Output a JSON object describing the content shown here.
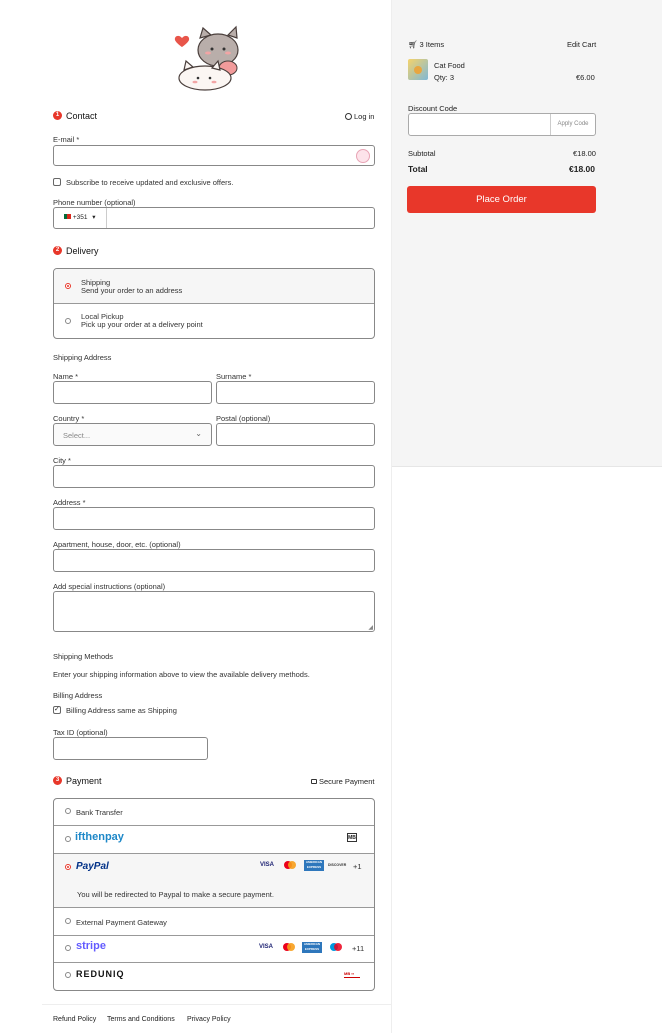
{
  "contact": {
    "step": "1",
    "title": "Contact",
    "login_label": "Log in",
    "email_label": "E-mail *",
    "email_value": "",
    "subscribe_label": "Subscribe to receive updated and exclusive offers.",
    "phone_label": "Phone number (optional)",
    "phone_code": "+351",
    "phone_value": ""
  },
  "delivery": {
    "step": "2",
    "title": "Delivery",
    "options": [
      {
        "title": "Shipping",
        "desc": "Send your order to an address",
        "selected": true
      },
      {
        "title": "Local Pickup",
        "desc": "Pick up your order at a delivery point",
        "selected": false
      }
    ]
  },
  "shipping_address": {
    "title": "Shipping Address",
    "name_label": "Name *",
    "surname_label": "Surname *",
    "country_label": "Country *",
    "country_placeholder": "Select...",
    "postal_label": "Postal (optional)",
    "city_label": "City *",
    "address_label": "Address *",
    "apartment_label": "Apartment, house, door, etc. (optional)",
    "instructions_label": "Add special instructions (optional)"
  },
  "shipping_methods": {
    "title": "Shipping Methods",
    "text": "Enter your shipping information above to view the available delivery methods."
  },
  "billing": {
    "title": "Billing Address",
    "same_label": "Billing Address same as Shipping",
    "tax_label": "Tax ID (optional)"
  },
  "payment": {
    "step": "3",
    "title": "Payment",
    "secure_label": "Secure Payment",
    "bank_transfer": "Bank Transfer",
    "ifthenpay": "ifthenpay",
    "paypal": "PayPal",
    "paypal_note": "You will be redirected to Paypal to make a secure payment.",
    "paypal_more": "+1",
    "external": "External Payment Gateway",
    "stripe": "stripe",
    "stripe_more": "+11",
    "reduniq": "REDUNIQ",
    "card_visa": "VISA",
    "card_discover": "DISCOVER",
    "card_amex": "AMERICAN EXPRESS",
    "card_mb": "MB"
  },
  "cart": {
    "items_label": "3 Items",
    "edit_label": "Edit Cart",
    "product_name": "Cat Food",
    "product_qty": "Qty: 3",
    "product_price": "€6.00",
    "discount_label": "Discount Code",
    "apply_label": "Apply Code",
    "subtotal_label": "Subtotal",
    "subtotal_value": "€18.00",
    "total_label": "Total",
    "total_value": "€18.00",
    "place_order": "Place Order"
  },
  "footer": {
    "refund": "Refund Policy",
    "terms": "Terms and Conditions",
    "privacy": "Privacy Policy"
  },
  "colors": {
    "accent": "#e8372a",
    "paypal_blue": "#003087",
    "stripe_purple": "#635bff",
    "ifthenpay_blue": "#1e88c8"
  }
}
